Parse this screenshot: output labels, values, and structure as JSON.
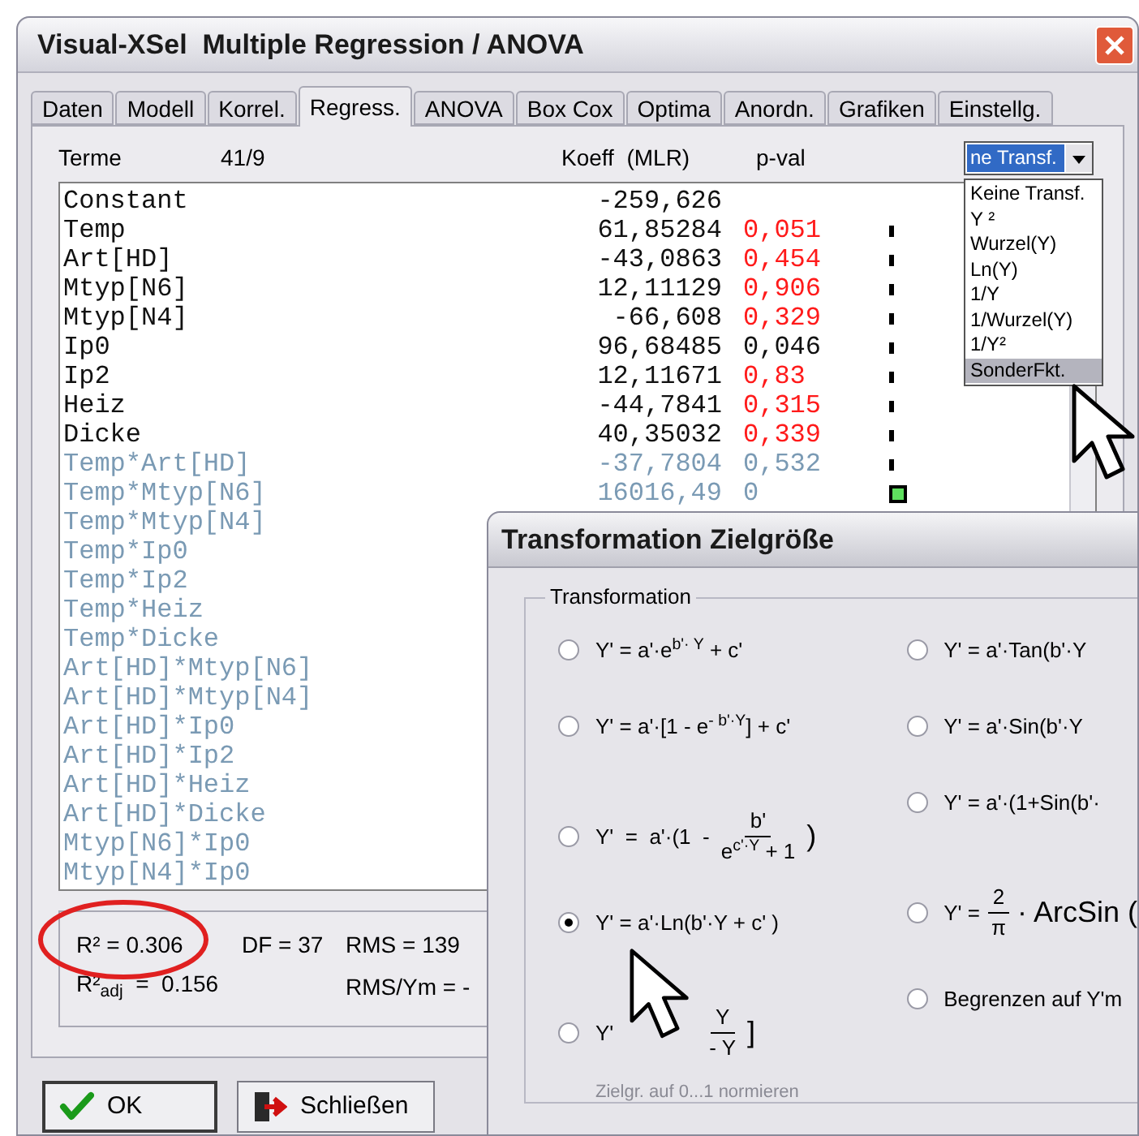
{
  "main_window": {
    "title": "Visual-XSel  Multiple Regression / ANOVA"
  },
  "tabs": [
    {
      "label": "Daten",
      "selected": false
    },
    {
      "label": "Modell",
      "selected": false
    },
    {
      "label": "Korrel.",
      "selected": false
    },
    {
      "label": "Regress.",
      "selected": true
    },
    {
      "label": "ANOVA",
      "selected": false
    },
    {
      "label": "Box Cox",
      "selected": false
    },
    {
      "label": "Optima",
      "selected": false
    },
    {
      "label": "Anordn.",
      "selected": false
    },
    {
      "label": "Grafiken",
      "selected": false
    },
    {
      "label": "Einstellg.",
      "selected": false
    }
  ],
  "header": {
    "terms_label": "Terme",
    "count": "41/9",
    "coef_label": "Koeff  (MLR)",
    "pval_label": "p-val"
  },
  "transform_dropdown": {
    "value": "ne Transf.",
    "expanded": true,
    "options": [
      {
        "label": "Keine Transf.",
        "selected": false
      },
      {
        "label": "Y ²",
        "selected": false
      },
      {
        "label": "Wurzel(Y)",
        "selected": false
      },
      {
        "label": "Ln(Y)",
        "selected": false
      },
      {
        "label": "1/Y",
        "selected": false
      },
      {
        "label": "1/Wurzel(Y)",
        "selected": false
      },
      {
        "label": "1/Y²",
        "selected": false
      },
      {
        "label": "SonderFkt.",
        "selected": true
      }
    ]
  },
  "terms": [
    {
      "name": "Constant",
      "kind": "main",
      "coef": "-259,626"
    },
    {
      "name": "Temp",
      "kind": "main",
      "coef": "61,85284",
      "pval": "0,051",
      "flagged": true,
      "marker": true,
      "marker_highlighted": false
    },
    {
      "name": "Art[HD]",
      "kind": "main",
      "coef": "-43,0863",
      "pval": "0,454",
      "flagged": true,
      "marker": true,
      "marker_highlighted": false
    },
    {
      "name": "Mtyp[N6]",
      "kind": "main",
      "coef": "12,11129",
      "pval": "0,906",
      "flagged": true,
      "marker": true,
      "marker_highlighted": false
    },
    {
      "name": "Mtyp[N4]",
      "kind": "main",
      "coef": "-66,608",
      "pval": "0,329",
      "flagged": true,
      "marker": true,
      "marker_highlighted": false
    },
    {
      "name": "Ip0",
      "kind": "main",
      "coef": "96,68485",
      "pval": "0,046",
      "flagged": false,
      "marker": true,
      "marker_highlighted": false
    },
    {
      "name": "Ip2",
      "kind": "main",
      "coef": "12,11671",
      "pval": "0,83",
      "flagged": true,
      "marker": true,
      "marker_highlighted": false
    },
    {
      "name": "Heiz",
      "kind": "main",
      "coef": "-44,7841",
      "pval": "0,315",
      "flagged": true,
      "marker": true,
      "marker_highlighted": false
    },
    {
      "name": "Dicke",
      "kind": "main",
      "coef": "40,35032",
      "pval": "0,339",
      "flagged": true,
      "marker": true,
      "marker_highlighted": false
    },
    {
      "name": "Temp*Art[HD]",
      "kind": "interaction",
      "coef": "-37,7804",
      "pval": "0,532",
      "flagged": false,
      "marker": true,
      "marker_highlighted": false
    },
    {
      "name": "Temp*Mtyp[N6]",
      "kind": "interaction",
      "coef": "16016,49",
      "pval": "0",
      "flagged": false,
      "marker": true,
      "marker_highlighted": true
    },
    {
      "name": "Temp*Mtyp[N4]",
      "kind": "interaction"
    },
    {
      "name": "Temp*Ip0",
      "kind": "interaction"
    },
    {
      "name": "Temp*Ip2",
      "kind": "interaction"
    },
    {
      "name": "Temp*Heiz",
      "kind": "interaction"
    },
    {
      "name": "Temp*Dicke",
      "kind": "interaction"
    },
    {
      "name": "Art[HD]*Mtyp[N6]",
      "kind": "interaction"
    },
    {
      "name": "Art[HD]*Mtyp[N4]",
      "kind": "interaction"
    },
    {
      "name": "Art[HD]*Ip0",
      "kind": "interaction"
    },
    {
      "name": "Art[HD]*Ip2",
      "kind": "interaction"
    },
    {
      "name": "Art[HD]*Heiz",
      "kind": "interaction"
    },
    {
      "name": "Art[HD]*Dicke",
      "kind": "interaction"
    },
    {
      "name": "Mtyp[N6]*Ip0",
      "kind": "interaction"
    },
    {
      "name": "Mtyp[N4]*Ip0",
      "kind": "interaction"
    }
  ],
  "stats": {
    "r2": "R² = 0.306",
    "df": "DF = 37",
    "rms": "RMS = 139",
    "r2_adj": "R²$_{adj}$  =  0.156",
    "rms_ym": "RMS/Ym = -"
  },
  "buttons": [
    {
      "label": "OK"
    },
    {
      "label": "Schließen"
    }
  ],
  "dialog": {
    "title": "Transformation Zielgröße",
    "group_label": "Transformation",
    "left_options": [
      {
        "kind": "inline",
        "formula": "Y' = a'·e$^{b'· Y}$ + c'",
        "selected": false
      },
      {
        "kind": "inline",
        "formula": "Y' = a'·[1 - e$^{- b'·Y}$] + c'",
        "selected": false
      },
      {
        "kind": "fraction",
        "prefix": "Y'  =  a'·(1  -",
        "numerator": "b'",
        "denominator": "e$^{c'·Y}$ + 1",
        "suffix": ")",
        "selected": false
      },
      {
        "kind": "inline",
        "formula": "Y' = a'·Ln(b'·Y + c' )",
        "selected": true
      },
      {
        "kind": "fraction",
        "prefix": "Y'",
        "numerator": "Y",
        "denominator": "- Y",
        "suffix": "]",
        "selected": false,
        "note": "Zielgr. auf 0...1 normieren",
        "note_disabled": true
      }
    ],
    "right_options": [
      {
        "kind": "inline",
        "formula": "Y' = a'·Tan(b'·Y",
        "selected": false
      },
      {
        "kind": "inline",
        "formula": "Y' = a'·Sin(b'·Y",
        "selected": false
      },
      {
        "kind": "inline",
        "formula": "Y' = a'·(1+Sin(b'·",
        "selected": false
      },
      {
        "kind": "fraction",
        "prefix": "Y' =",
        "numerator": "2",
        "denominator": "π",
        "suffix": "· ArcSin (",
        "selected": false
      },
      {
        "kind": "inline",
        "formula": "Begrenzen auf Y'm",
        "selected": false
      }
    ]
  }
}
